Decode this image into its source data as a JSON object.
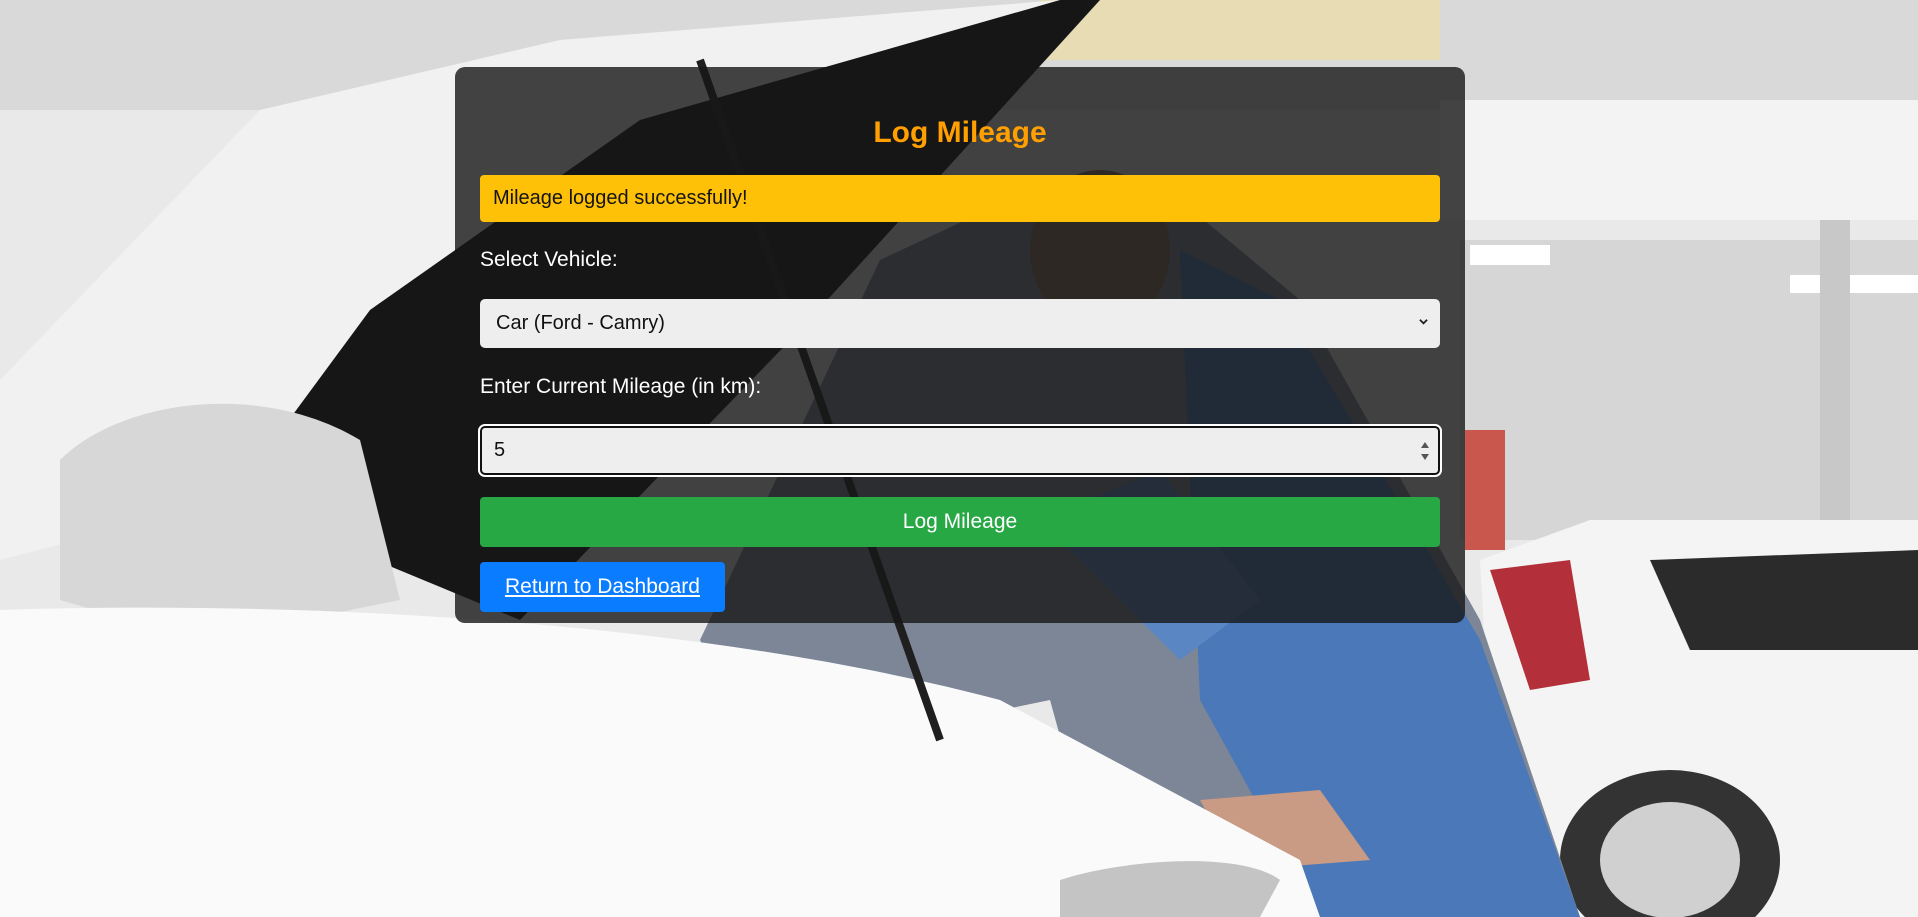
{
  "page": {
    "title": "Log Mileage"
  },
  "alert": {
    "message": "Mileage logged successfully!",
    "color": "#ffc107"
  },
  "vehicle": {
    "label": "Select Vehicle:",
    "selected": "Car (Ford - Camry)"
  },
  "mileage": {
    "label": "Enter Current Mileage (in km):",
    "value": "5"
  },
  "actions": {
    "submit_label": "Log Mileage",
    "submit_color": "#28a745",
    "dashboard_label": "Return to Dashboard",
    "dashboard_color": "#0a7cff"
  },
  "icons": {
    "select_arrow": "chevron-down-icon",
    "number_spinner": "spinner-icon"
  },
  "colors": {
    "title": "#ffa000",
    "panel": "rgba(22,22,22,0.80)"
  }
}
